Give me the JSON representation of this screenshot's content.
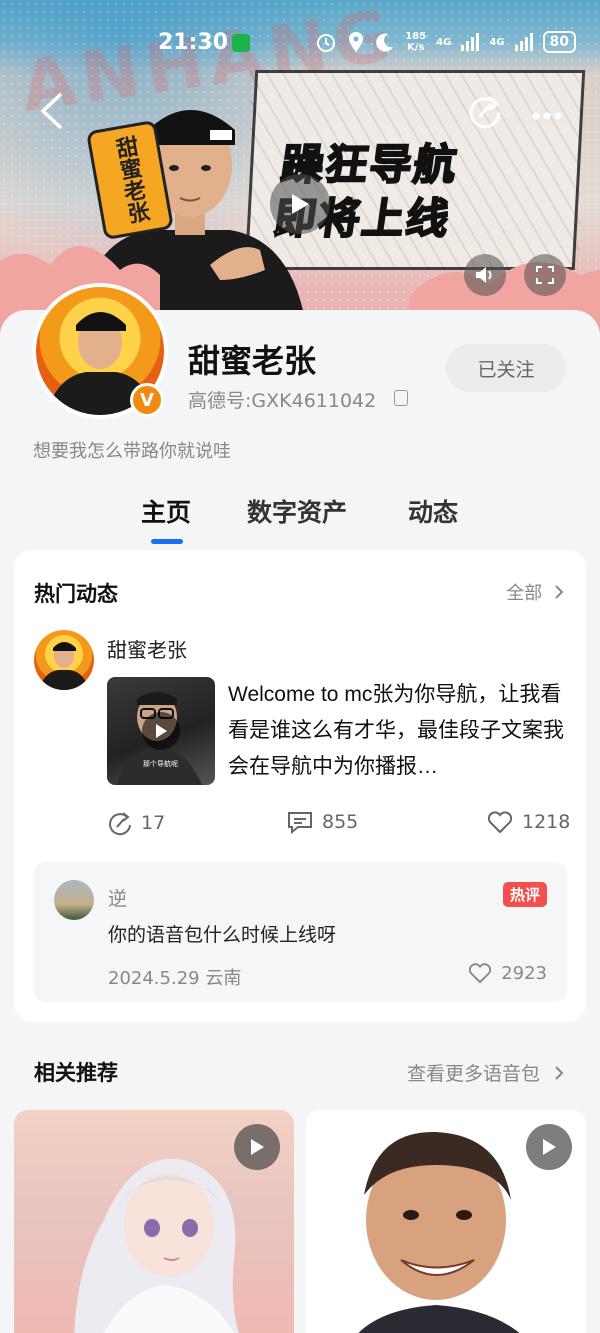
{
  "status_bar": {
    "time": "21:30",
    "net_speed_value": "185",
    "net_speed_unit": "K/s",
    "signal1_label": "4G",
    "signal2_label": "4G",
    "battery": "80"
  },
  "banner": {
    "watermark": "ANHANG",
    "headline_line1": "躁狂导航",
    "headline_line2": "即将上线",
    "name_tag": "甜蜜老张"
  },
  "profile": {
    "name": "甜蜜老张",
    "id_label": "高德号:",
    "id_value": "GXK4611042",
    "follow_label": "已关注",
    "bio": "想要我怎么带路你就说哇",
    "badge": "V"
  },
  "tabs": [
    {
      "label": "主页",
      "active": true
    },
    {
      "label": "数字资产",
      "active": false
    },
    {
      "label": "动态",
      "active": false
    }
  ],
  "hot_posts": {
    "title": "热门动态",
    "more": "全部",
    "post": {
      "author": "甜蜜老张",
      "thumb_caption": "那个导航呢",
      "text": "Welcome to mc张为你导航，让我看看是谁这么有才华，最佳段子文案我会在导航中为你播报…",
      "shares": "17",
      "comments": "855",
      "likes": "1218"
    },
    "top_comment": {
      "user": "逆",
      "badge": "热评",
      "text": "你的语音包什么时候上线呀",
      "meta": "2024.5.29 云南",
      "likes": "2923"
    }
  },
  "recommend": {
    "title": "相关推荐",
    "more": "查看更多语音包"
  },
  "colors": {
    "accent": "#1d6ff2",
    "hot_badge": "#f24f4f",
    "verified": "#f08a10"
  }
}
